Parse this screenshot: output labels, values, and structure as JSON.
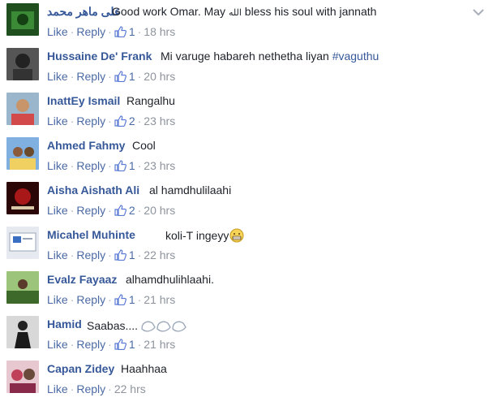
{
  "comments": [
    {
      "name": "على ماهر محمد",
      "text": "Good work Omar. May",
      "arabic_word": "الله",
      "text_end": "bless his soul with jannath",
      "like_label": "Like",
      "reply_label": "Reply",
      "likes": "1",
      "time": "18 hrs",
      "avatar_color": "#2d6a2a"
    },
    {
      "name": "Hussaine De' Frank",
      "text": "Mi varuge habareh nethetha liyan",
      "hashtag": "#vaguthu",
      "like_label": "Like",
      "reply_label": "Reply",
      "likes": "1",
      "time": "20 hrs",
      "avatar_color": "#3c3c3c"
    },
    {
      "name": "InattEy Ismail",
      "text": "Rangalhu",
      "like_label": "Like",
      "reply_label": "Reply",
      "likes": "2",
      "time": "23 hrs",
      "avatar_color": "#6f8fa8"
    },
    {
      "name": "Ahmed Fahmy",
      "text": "Cool",
      "like_label": "Like",
      "reply_label": "Reply",
      "likes": "1",
      "time": "23 hrs",
      "avatar_color": "#5b8fc7"
    },
    {
      "name": "Aisha Aishath Ali",
      "text": "al hamdhulilaahi",
      "like_label": "Like",
      "reply_label": "Reply",
      "likes": "2",
      "time": "20 hrs",
      "avatar_color": "#7a1010"
    },
    {
      "name": "Micahel Muhinte",
      "text": "koli-T ingeyy",
      "like_label": "Like",
      "reply_label": "Reply",
      "likes": "1",
      "time": "22 hrs",
      "avatar_color": "#cfd6e0"
    },
    {
      "name": "Evalz Fayaaz",
      "text": "alhamdhulihlaahi.",
      "like_label": "Like",
      "reply_label": "Reply",
      "likes": "1",
      "time": "21 hrs",
      "avatar_color": "#4f7a3a"
    },
    {
      "name": "Hamid",
      "text": "Saabas....",
      "like_label": "Like",
      "reply_label": "Reply",
      "likes": "1",
      "time": "21 hrs",
      "avatar_color": "#2b2b2b"
    },
    {
      "name": "Capan Zidey",
      "text": "Haahhaa",
      "like_label": "Like",
      "reply_label": "Reply",
      "time": "22 hrs",
      "avatar_color": "#9a5a6a"
    }
  ],
  "colors": {
    "name": "#365899",
    "link": "#4b6aa5",
    "meta": "#8d949e",
    "text": "#1d2129"
  },
  "icons": {
    "thumb": "thumbs-up-icon",
    "chevron": "chevron-down-icon",
    "emoji": "grimacing-face-emoji",
    "sticker": "clapping-hands-sticker"
  }
}
